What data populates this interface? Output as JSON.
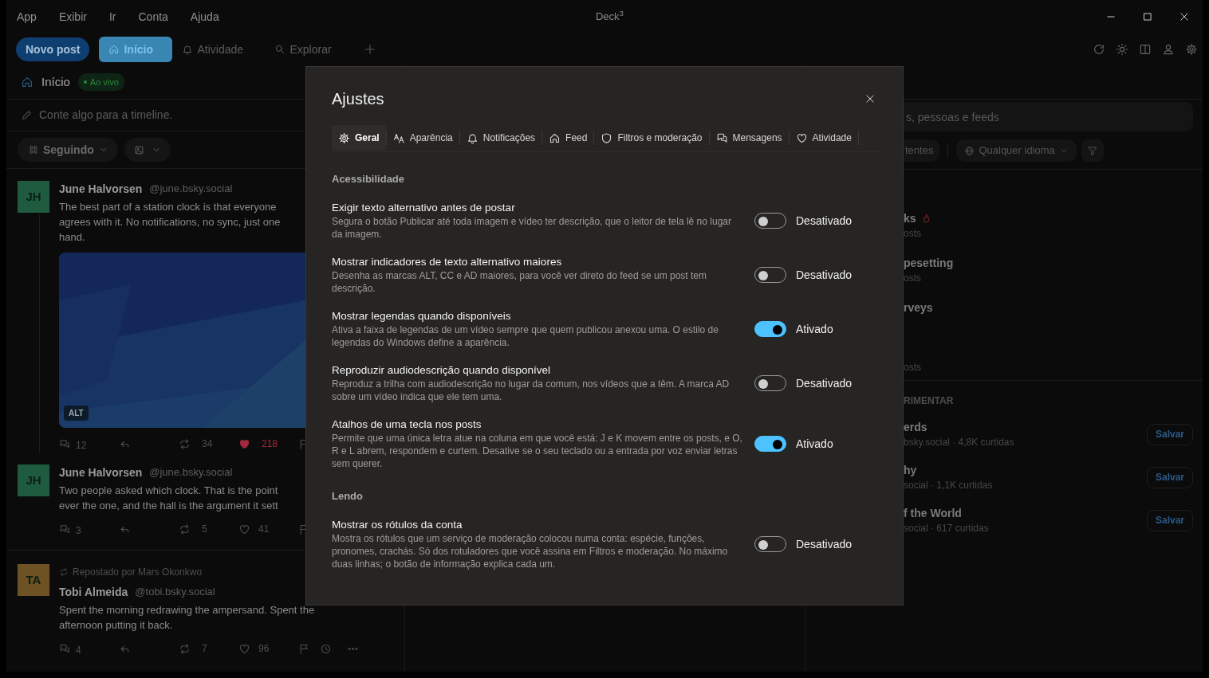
{
  "window": {
    "menus": [
      "App",
      "Exibir",
      "Ir",
      "Conta",
      "Ajuda"
    ],
    "title": "Deck$^{3}$"
  },
  "toolbar": {
    "new_post": "Novo post",
    "tabs": [
      {
        "label": "Início",
        "selected": true
      },
      {
        "label": "Atividade",
        "selected": false
      },
      {
        "label": "Explorar",
        "selected": false
      }
    ]
  },
  "home_column": {
    "title": "Início",
    "live_badge": "Ao vivo",
    "composer": {
      "placeholder": "Conte algo para a timeline."
    },
    "filters": [
      {
        "kind": "feed",
        "label": "Seguindo"
      },
      {
        "kind": "media"
      }
    ],
    "posts": [
      {
        "avatar": "JH",
        "color": "#1f5c3f",
        "name": "June Halvorsen",
        "handle": "@june.bsky.social",
        "lines": [
          "The best part of a station clock is that everyone",
          "agrees with it. No notifications, no sync, just one",
          "hand."
        ],
        "image": {
          "kind": "picture",
          "badge": "ALT"
        },
        "thread": true,
        "replies": "12",
        "reposts": "34",
        "likes": "218",
        "liked": true
      },
      {
        "avatar": "JH",
        "color": "#1f5c3f",
        "name": "June Halvorsen",
        "handle": "@june.bsky.social",
        "lines": [
          "Two people asked which clock. That is the point",
          "ever the one, and the hall is the argument it sett"
        ],
        "thread": false,
        "replies": "3",
        "reposts": "5",
        "likes": "41",
        "liked": false
      },
      {
        "avatar": "TA",
        "color": "#6e5224",
        "repost_by": "Repostado por Mars Okonkwo",
        "name": "Tobi Almeida",
        "handle": "@tobi.bsky.social",
        "lines": [
          "Spent the morning redrawing the ampersand. Spent the",
          "afternoon putting it back."
        ],
        "thread": false,
        "replies": "4",
        "reposts": "7",
        "likes": "96",
        "liked": false,
        "more_tools": true
      }
    ]
  },
  "discover_column": {
    "search": {
      "placeholder": "s, pessoas e feeds"
    },
    "filters": [
      {
        "kind": "chip",
        "label": "tentes"
      },
      {
        "kind": "language",
        "label": "Qualquer idioma"
      },
      {
        "kind": "filter"
      }
    ],
    "trending": [
      {
        "title": "ks",
        "hot": true,
        "meta": "osts"
      },
      {
        "title": "pesetting",
        "hot": false,
        "meta": "osts"
      },
      {
        "title": "rveys",
        "hot": false,
        "meta": "osts"
      }
    ],
    "suggest_heading": "RIMENTAR",
    "feeds": [
      {
        "title": "erds",
        "meta": "bsky.social · 4,8K curtidas",
        "action": "Salvar"
      },
      {
        "title": "hy",
        "meta": "social · 1,1K curtidas",
        "action": "Salvar"
      },
      {
        "title": "f the World",
        "meta": "social · 617 curtidas",
        "action": "Salvar"
      }
    ]
  },
  "settings": {
    "title": "Ajustes",
    "tabs": [
      {
        "label": "Geral",
        "selected": true
      },
      {
        "label": "Aparência",
        "selected": false
      },
      {
        "label": "Notificações",
        "selected": false
      },
      {
        "label": "Feed",
        "selected": false
      },
      {
        "label": "Filtros e moderação",
        "selected": false
      },
      {
        "label": "Mensagens",
        "selected": false
      },
      {
        "label": "Atividade",
        "selected": false
      }
    ],
    "sections": [
      {
        "heading": "Acessibilidade",
        "items": [
          {
            "title": "Exigir texto alternativo antes de postar",
            "description": "Segura o botão Publicar até toda imagem e vídeo ter descrição, que o leitor de tela lê no lugar da imagem.",
            "on": false,
            "status": "Desativado"
          },
          {
            "title": "Mostrar indicadores de texto alternativo maiores",
            "description": "Desenha as marcas ALT, CC e AD maiores, para você ver direto do feed se um post tem descrição.",
            "on": false,
            "status": "Desativado"
          },
          {
            "title": "Mostrar legendas quando disponíveis",
            "description": "Ativa a faixa de legendas de um vídeo sempre que quem publicou anexou uma. O estilo de legendas do Windows define a aparência.",
            "on": true,
            "status": "Ativado"
          },
          {
            "title": "Reproduzir audiodescrição quando disponível",
            "description": "Reproduz a trilha com audiodescrição no lugar da comum, nos vídeos que a têm. A marca AD sobre um vídeo indica que ele tem uma.",
            "on": false,
            "status": "Desativado"
          },
          {
            "title": "Atalhos de uma tecla nos posts",
            "description": "Permite que uma única letra atue na coluna em que você está: J e K movem entre os posts, e O, R e L abrem, respondem e curtem. Desative se o seu teclado ou a entrada por voz enviar letras sem querer.",
            "on": true,
            "status": "Ativado"
          }
        ]
      },
      {
        "heading": "Lendo",
        "items": [
          {
            "title": "Mostrar os rótulos da conta",
            "description": "Mostra os rótulos que um serviço de moderação colocou numa conta: espécie, funções, pronomes, crachás. Só dos rotuladores que você assina em Filtros e moderação. No máximo duas linhas; o botão de informação explica cada um.",
            "on": false,
            "status": "Desativado"
          }
        ]
      }
    ]
  }
}
